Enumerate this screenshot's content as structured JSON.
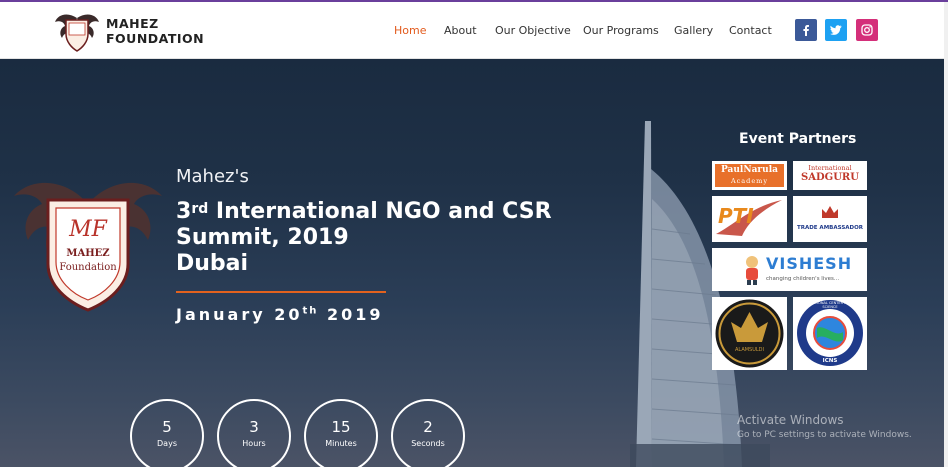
{
  "brand": {
    "name_line1": "MAHEZ",
    "name_line2": "FOUNDATION",
    "emblem_monogram": "MF",
    "emblem_line1": "MAHEZ",
    "emblem_line2": "Foundation"
  },
  "nav": {
    "items": [
      {
        "label": "Home",
        "active": true
      },
      {
        "label": "About",
        "active": false
      },
      {
        "label": "Our Objective",
        "active": false
      },
      {
        "label": "Our Programs",
        "active": false
      },
      {
        "label": "Gallery",
        "active": false
      },
      {
        "label": "Contact",
        "active": false
      }
    ],
    "active_color": "#e25a1c"
  },
  "social": [
    {
      "icon": "facebook-icon",
      "glyph": "f",
      "color": "#3b5998"
    },
    {
      "icon": "twitter-icon",
      "glyph": "t",
      "color": "#1da1f2"
    },
    {
      "icon": "instagram-icon",
      "glyph": "◎",
      "color": "#c13584"
    }
  ],
  "hero": {
    "intro": "Mahez's",
    "ordinal_num": "3",
    "ordinal_suffix": "rd",
    "title_rest": " International NGO and CSR",
    "title_line2": "Summit, 2019",
    "title_line3": "Dubai",
    "date_pre": "January 20",
    "date_suffix": "th",
    "date_post": " 2019",
    "accent_color": "#e2621e"
  },
  "countdown": [
    {
      "value": "5",
      "label": "Days"
    },
    {
      "value": "3",
      "label": "Hours"
    },
    {
      "value": "15",
      "label": "Minutes"
    },
    {
      "value": "2",
      "label": "Seconds"
    }
  ],
  "partners": {
    "title": "Event Partners",
    "paulnarula_line1": "PaulNarula",
    "paulnarula_line2": "Academy",
    "sadguru_line1": "International",
    "sadguru_line2": "SADGURU",
    "pti": "PTI",
    "trade_ambassador": "TRADE AMBASSADOR",
    "vishesh": "VISHESH",
    "vishesh_tagline": "changing children's lives...",
    "alamsuldi": "ALAMSULDI",
    "icns": "ICNS",
    "icns_ring": "INTERNATIONAL CENTER NATURAL SCIENCE"
  },
  "windows_watermark": {
    "title": "Activate Windows",
    "subtitle": "Go to PC settings to activate Windows."
  }
}
